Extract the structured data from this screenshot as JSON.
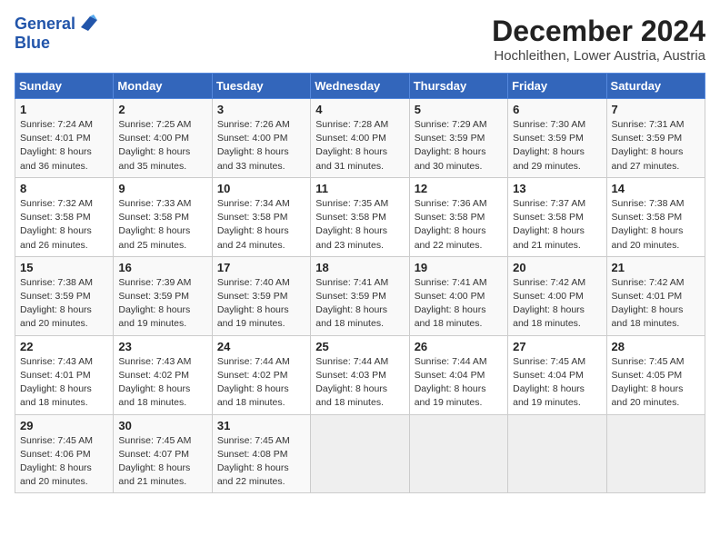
{
  "header": {
    "logo_general": "General",
    "logo_blue": "Blue",
    "title": "December 2024",
    "subtitle": "Hochleithen, Lower Austria, Austria"
  },
  "calendar": {
    "days_of_week": [
      "Sunday",
      "Monday",
      "Tuesday",
      "Wednesday",
      "Thursday",
      "Friday",
      "Saturday"
    ],
    "weeks": [
      [
        {
          "day": "1",
          "sunrise": "Sunrise: 7:24 AM",
          "sunset": "Sunset: 4:01 PM",
          "daylight": "Daylight: 8 hours and 36 minutes."
        },
        {
          "day": "2",
          "sunrise": "Sunrise: 7:25 AM",
          "sunset": "Sunset: 4:00 PM",
          "daylight": "Daylight: 8 hours and 35 minutes."
        },
        {
          "day": "3",
          "sunrise": "Sunrise: 7:26 AM",
          "sunset": "Sunset: 4:00 PM",
          "daylight": "Daylight: 8 hours and 33 minutes."
        },
        {
          "day": "4",
          "sunrise": "Sunrise: 7:28 AM",
          "sunset": "Sunset: 4:00 PM",
          "daylight": "Daylight: 8 hours and 31 minutes."
        },
        {
          "day": "5",
          "sunrise": "Sunrise: 7:29 AM",
          "sunset": "Sunset: 3:59 PM",
          "daylight": "Daylight: 8 hours and 30 minutes."
        },
        {
          "day": "6",
          "sunrise": "Sunrise: 7:30 AM",
          "sunset": "Sunset: 3:59 PM",
          "daylight": "Daylight: 8 hours and 29 minutes."
        },
        {
          "day": "7",
          "sunrise": "Sunrise: 7:31 AM",
          "sunset": "Sunset: 3:59 PM",
          "daylight": "Daylight: 8 hours and 27 minutes."
        }
      ],
      [
        {
          "day": "8",
          "sunrise": "Sunrise: 7:32 AM",
          "sunset": "Sunset: 3:58 PM",
          "daylight": "Daylight: 8 hours and 26 minutes."
        },
        {
          "day": "9",
          "sunrise": "Sunrise: 7:33 AM",
          "sunset": "Sunset: 3:58 PM",
          "daylight": "Daylight: 8 hours and 25 minutes."
        },
        {
          "day": "10",
          "sunrise": "Sunrise: 7:34 AM",
          "sunset": "Sunset: 3:58 PM",
          "daylight": "Daylight: 8 hours and 24 minutes."
        },
        {
          "day": "11",
          "sunrise": "Sunrise: 7:35 AM",
          "sunset": "Sunset: 3:58 PM",
          "daylight": "Daylight: 8 hours and 23 minutes."
        },
        {
          "day": "12",
          "sunrise": "Sunrise: 7:36 AM",
          "sunset": "Sunset: 3:58 PM",
          "daylight": "Daylight: 8 hours and 22 minutes."
        },
        {
          "day": "13",
          "sunrise": "Sunrise: 7:37 AM",
          "sunset": "Sunset: 3:58 PM",
          "daylight": "Daylight: 8 hours and 21 minutes."
        },
        {
          "day": "14",
          "sunrise": "Sunrise: 7:38 AM",
          "sunset": "Sunset: 3:58 PM",
          "daylight": "Daylight: 8 hours and 20 minutes."
        }
      ],
      [
        {
          "day": "15",
          "sunrise": "Sunrise: 7:38 AM",
          "sunset": "Sunset: 3:59 PM",
          "daylight": "Daylight: 8 hours and 20 minutes."
        },
        {
          "day": "16",
          "sunrise": "Sunrise: 7:39 AM",
          "sunset": "Sunset: 3:59 PM",
          "daylight": "Daylight: 8 hours and 19 minutes."
        },
        {
          "day": "17",
          "sunrise": "Sunrise: 7:40 AM",
          "sunset": "Sunset: 3:59 PM",
          "daylight": "Daylight: 8 hours and 19 minutes."
        },
        {
          "day": "18",
          "sunrise": "Sunrise: 7:41 AM",
          "sunset": "Sunset: 3:59 PM",
          "daylight": "Daylight: 8 hours and 18 minutes."
        },
        {
          "day": "19",
          "sunrise": "Sunrise: 7:41 AM",
          "sunset": "Sunset: 4:00 PM",
          "daylight": "Daylight: 8 hours and 18 minutes."
        },
        {
          "day": "20",
          "sunrise": "Sunrise: 7:42 AM",
          "sunset": "Sunset: 4:00 PM",
          "daylight": "Daylight: 8 hours and 18 minutes."
        },
        {
          "day": "21",
          "sunrise": "Sunrise: 7:42 AM",
          "sunset": "Sunset: 4:01 PM",
          "daylight": "Daylight: 8 hours and 18 minutes."
        }
      ],
      [
        {
          "day": "22",
          "sunrise": "Sunrise: 7:43 AM",
          "sunset": "Sunset: 4:01 PM",
          "daylight": "Daylight: 8 hours and 18 minutes."
        },
        {
          "day": "23",
          "sunrise": "Sunrise: 7:43 AM",
          "sunset": "Sunset: 4:02 PM",
          "daylight": "Daylight: 8 hours and 18 minutes."
        },
        {
          "day": "24",
          "sunrise": "Sunrise: 7:44 AM",
          "sunset": "Sunset: 4:02 PM",
          "daylight": "Daylight: 8 hours and 18 minutes."
        },
        {
          "day": "25",
          "sunrise": "Sunrise: 7:44 AM",
          "sunset": "Sunset: 4:03 PM",
          "daylight": "Daylight: 8 hours and 18 minutes."
        },
        {
          "day": "26",
          "sunrise": "Sunrise: 7:44 AM",
          "sunset": "Sunset: 4:04 PM",
          "daylight": "Daylight: 8 hours and 19 minutes."
        },
        {
          "day": "27",
          "sunrise": "Sunrise: 7:45 AM",
          "sunset": "Sunset: 4:04 PM",
          "daylight": "Daylight: 8 hours and 19 minutes."
        },
        {
          "day": "28",
          "sunrise": "Sunrise: 7:45 AM",
          "sunset": "Sunset: 4:05 PM",
          "daylight": "Daylight: 8 hours and 20 minutes."
        }
      ],
      [
        {
          "day": "29",
          "sunrise": "Sunrise: 7:45 AM",
          "sunset": "Sunset: 4:06 PM",
          "daylight": "Daylight: 8 hours and 20 minutes."
        },
        {
          "day": "30",
          "sunrise": "Sunrise: 7:45 AM",
          "sunset": "Sunset: 4:07 PM",
          "daylight": "Daylight: 8 hours and 21 minutes."
        },
        {
          "day": "31",
          "sunrise": "Sunrise: 7:45 AM",
          "sunset": "Sunset: 4:08 PM",
          "daylight": "Daylight: 8 hours and 22 minutes."
        },
        null,
        null,
        null,
        null
      ]
    ]
  }
}
